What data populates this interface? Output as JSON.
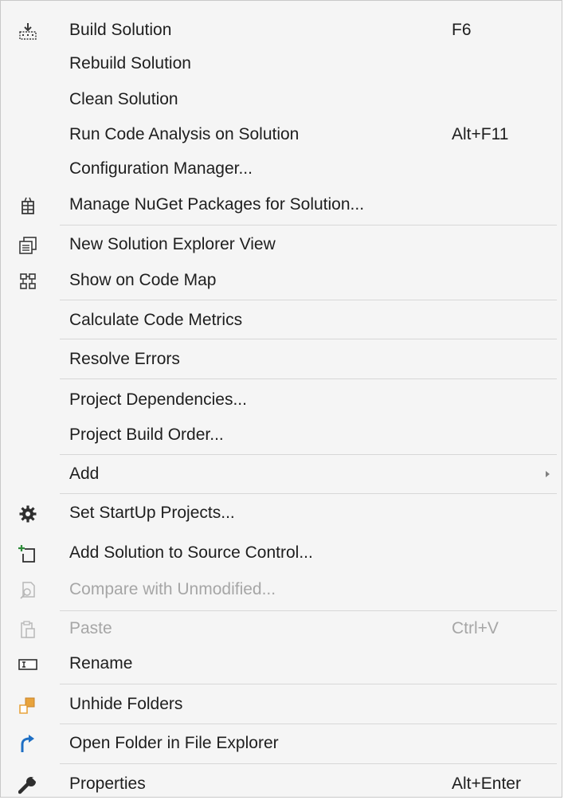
{
  "menu": {
    "items": [
      {
        "label": "Build Solution",
        "shortcut": "F6",
        "icon": "build-icon"
      },
      {
        "label": "Rebuild Solution"
      },
      {
        "label": "Clean Solution"
      },
      {
        "label": "Run Code Analysis on Solution",
        "shortcut": "Alt+F11"
      },
      {
        "label": "Configuration Manager..."
      },
      {
        "label": "Manage NuGet Packages for Solution...",
        "icon": "nuget-icon"
      },
      {
        "label": "New Solution Explorer View",
        "icon": "solution-explorer-icon"
      },
      {
        "label": "Show on Code Map",
        "icon": "code-map-icon"
      },
      {
        "label": "Calculate Code Metrics"
      },
      {
        "label": "Resolve Errors"
      },
      {
        "label": "Project Dependencies..."
      },
      {
        "label": "Project Build Order..."
      },
      {
        "label": "Add",
        "submenu": true
      },
      {
        "label": "Set StartUp Projects...",
        "icon": "gear-icon"
      },
      {
        "label": "Add Solution to Source Control...",
        "icon": "add-to-source-control-icon"
      },
      {
        "label": "Compare with Unmodified...",
        "icon": "compare-icon",
        "disabled": true
      },
      {
        "label": "Paste",
        "shortcut": "Ctrl+V",
        "icon": "paste-icon",
        "disabled": true
      },
      {
        "label": "Rename",
        "icon": "rename-icon"
      },
      {
        "label": "Unhide Folders",
        "icon": "unhide-folders-icon"
      },
      {
        "label": "Open Folder in File Explorer",
        "icon": "open-folder-icon"
      },
      {
        "label": "Properties",
        "shortcut": "Alt+Enter",
        "icon": "wrench-icon"
      }
    ]
  },
  "colors": {
    "background": "#f5f5f5",
    "text": "#1e1e1e",
    "disabled_text": "#a6a6a6",
    "separator": "#d7d7d7",
    "accent_blue": "#1e6fc4",
    "folder_orange": "#e8a33c"
  }
}
